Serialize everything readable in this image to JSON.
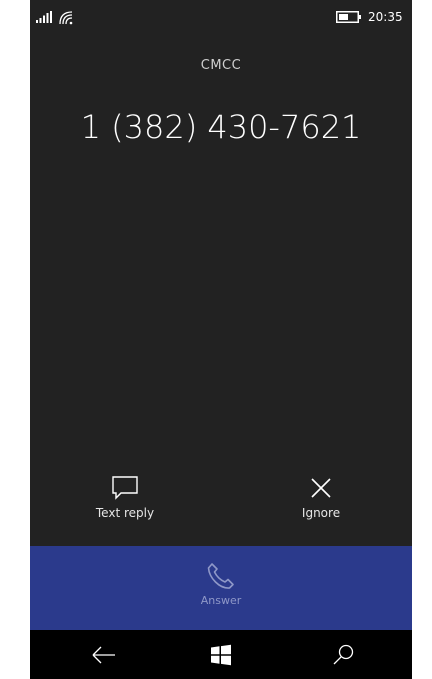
{
  "status_bar": {
    "time": "20:35",
    "icons": [
      "signal-icon",
      "wifi-icon",
      "battery-icon"
    ]
  },
  "call": {
    "carrier": "CMCC",
    "number": "1 (382) 430-7621"
  },
  "actions": {
    "text_reply": {
      "label": "Text reply",
      "icon": "message-icon"
    },
    "ignore": {
      "label": "Ignore",
      "icon": "close-icon"
    }
  },
  "answer": {
    "label": "Answer",
    "icon": "phone-icon",
    "color": "#2b3a8c"
  },
  "nav": {
    "icons": [
      "back-arrow-icon",
      "windows-icon",
      "search-icon"
    ]
  },
  "colors": {
    "background": "#222222",
    "answer_bar": "#2b3a8c",
    "nav_bar": "#000000"
  }
}
